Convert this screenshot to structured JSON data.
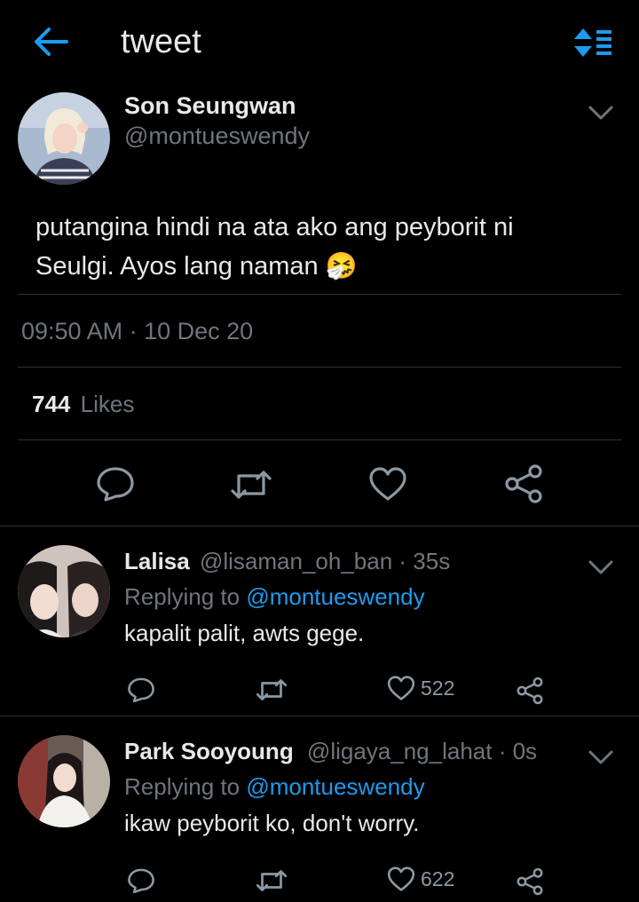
{
  "header": {
    "title": "tweet",
    "back_icon": "arrow-left-icon",
    "menu_icon": "sort-list-icon",
    "accent": "#1d9bf0"
  },
  "tweet": {
    "author_name": "Son Seungwan",
    "handle": "@montueswendy",
    "text": "putangina hindi na ata ako ang peyborit ni Seulgi. Ayos lang naman 🤧",
    "timestamp": "09:50 AM · 10 Dec 20",
    "likes_count": "744",
    "likes_label": "Likes",
    "actions": [
      "reply-icon",
      "retweet-icon",
      "like-icon",
      "share-icon"
    ]
  },
  "replies": [
    {
      "name": "Lalisa",
      "handle": "@lisaman_oh_ban",
      "time": "· 35s",
      "replying_prefix": "Replying to",
      "replying_to": "@montueswendy",
      "text": "kapalit palit, awts gege.",
      "likes": "522"
    },
    {
      "name": "Park Sooyoung",
      "handle": "@ligaya_ng_lahat",
      "time": "· 0s",
      "replying_prefix": "Replying to",
      "replying_to": "@montueswendy",
      "text": "ikaw peyborit ko, don't worry.",
      "likes": "622"
    }
  ]
}
